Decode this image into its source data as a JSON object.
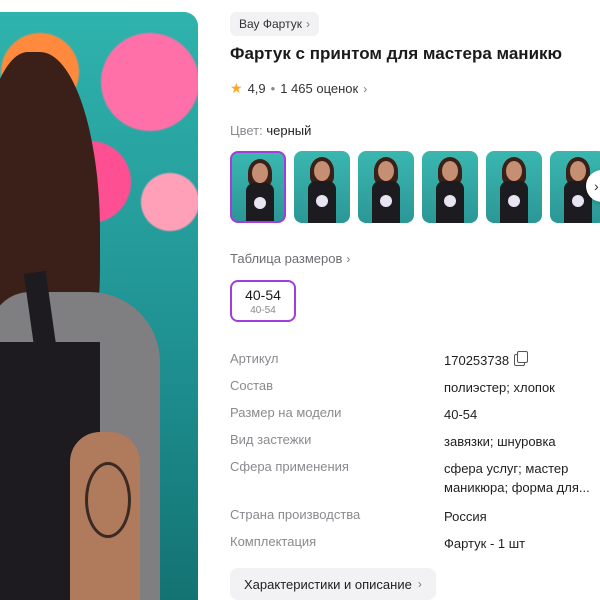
{
  "breadcrumb": {
    "label": "Вау Фартук"
  },
  "product": {
    "title": "Фартук с принтом для мастера маникю",
    "rating": "4,9",
    "reviews": "1 465 оценок"
  },
  "color": {
    "label": "Цвет:",
    "value": "черный"
  },
  "thumbnails": [
    {
      "selected": true
    },
    {
      "selected": false
    },
    {
      "selected": false
    },
    {
      "selected": false
    },
    {
      "selected": false
    },
    {
      "selected": false
    }
  ],
  "sizes": {
    "table_label": "Таблица размеров",
    "selected_main": "40-54",
    "selected_sub": "40-54"
  },
  "specs": [
    {
      "key": "Артикул",
      "value": "170253738"
    },
    {
      "key": "Состав",
      "value": "полиэстер; хлопок"
    },
    {
      "key": "Размер на модели",
      "value": "40-54"
    },
    {
      "key": "Вид застежки",
      "value": "завязки; шнуровка"
    },
    {
      "key": "Сфера применения",
      "value": "сфера услуг; мастер маникюра; форма для..."
    },
    {
      "key": "Страна производства",
      "value": "Россия"
    },
    {
      "key": "Комплектация",
      "value": "Фартук - 1 шт"
    }
  ],
  "details_button": {
    "label": "Характеристики и описание"
  },
  "colors": {
    "accent": "#a13dd9",
    "star": "#ffa626"
  }
}
